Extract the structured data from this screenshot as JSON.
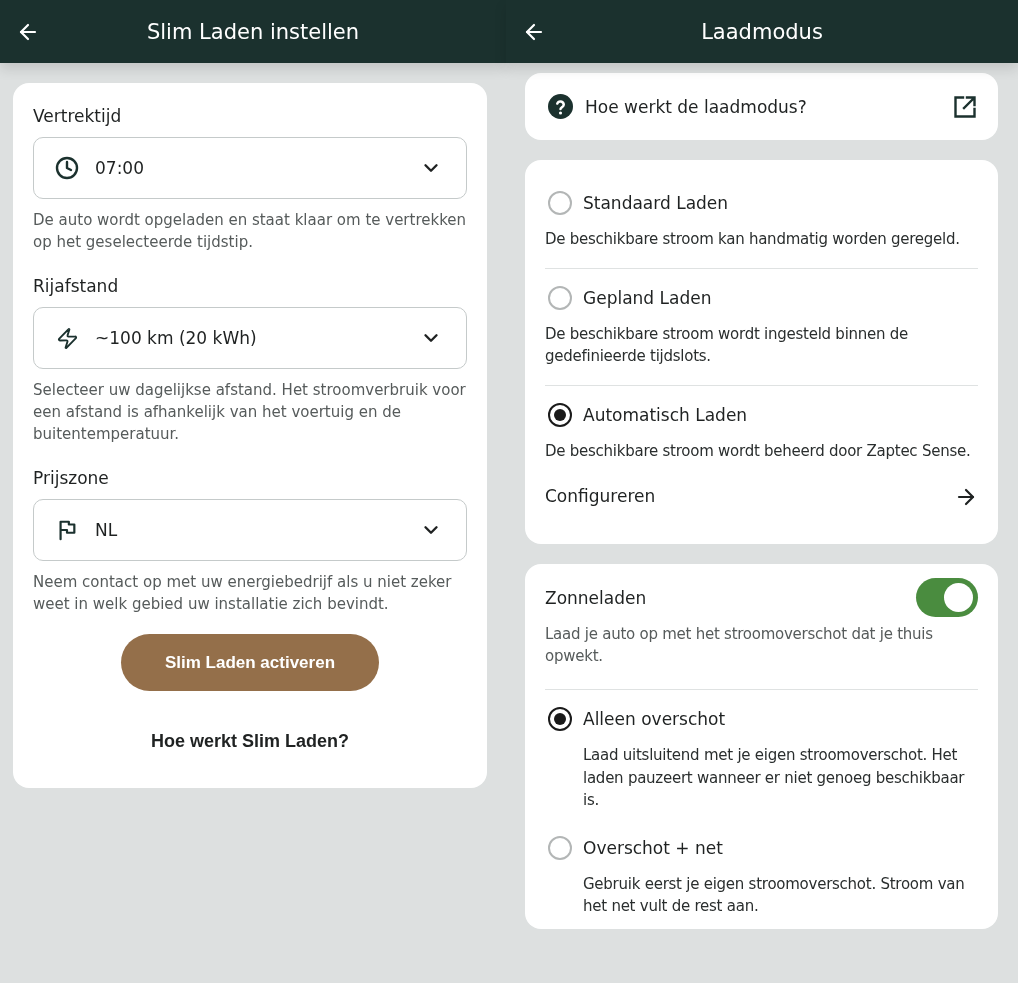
{
  "settings_screen": {
    "header": {
      "title": "Slim Laden instellen"
    },
    "fields": [
      {
        "label": "Vertrektijd",
        "value": "07:00",
        "helper": "De auto wordt opgeladen en staat klaar om te vertrekken op het geselecteerde tijdstip."
      },
      {
        "label": "Rijafstand",
        "value": "~100 km (20 kWh)",
        "helper": "Selecteer uw dagelijkse afstand. Het stroomverbruik voor een afstand is afhankelijk van het voertuig en de buitentemperatuur."
      },
      {
        "label": "Prijszone",
        "value": "NL",
        "helper": "Neem contact op met uw energiebedrijf als u niet zeker weet in welk gebied uw installatie zich bevindt."
      }
    ],
    "activate_button": "Slim Laden activeren",
    "help_link": "Hoe werkt Slim Laden?"
  },
  "mode_screen": {
    "header": {
      "title": "Laadmodus"
    },
    "help_card": {
      "text": "Hoe werkt de laadmodus?"
    },
    "modes": [
      {
        "label": "Standaard Laden",
        "description": "De beschikbare stroom kan handmatig worden geregeld.",
        "selected": false
      },
      {
        "label": "Gepland Laden",
        "description": "De beschikbare stroom wordt ingesteld binnen de gedefinieerde tijdslots.",
        "selected": false
      },
      {
        "label": "Automatisch Laden",
        "description": "De beschikbare stroom wordt beheerd door Zaptec Sense.",
        "selected": true
      }
    ],
    "configure_link": "Configureren",
    "solar": {
      "title": "Zonneladen",
      "on": true,
      "description": "Laad je auto op met het stroomoverschot dat je thuis opwekt.",
      "options": [
        {
          "label": "Alleen overschot",
          "description": "Laad uitsluitend met je eigen stroomoverschot. Het laden pauzeert wanneer er niet genoeg beschikbaar is.",
          "selected": true
        },
        {
          "label": "Overschot + net",
          "description": "Gebruik eerst je eigen stroomoverschot. Stroom van het net vult de rest aan.",
          "selected": false
        }
      ]
    }
  }
}
